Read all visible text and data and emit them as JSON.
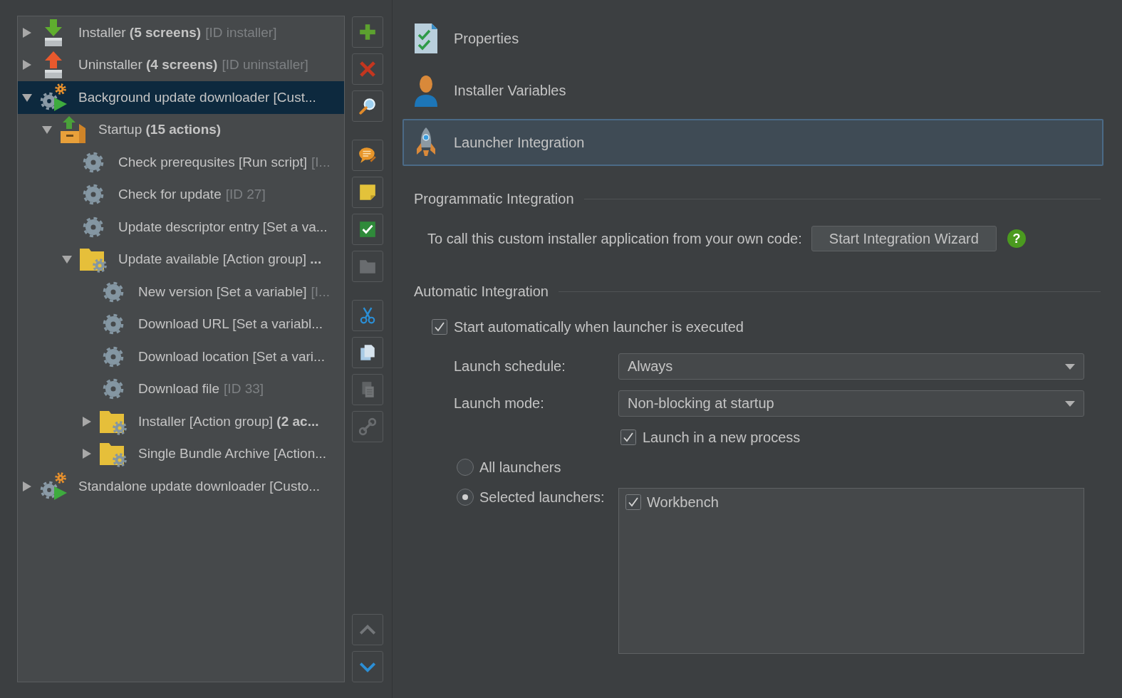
{
  "tree": {
    "items": [
      {
        "kind": "installer",
        "label": "Installer **(5 screens)**",
        "id_note": "[ID installer]",
        "expanded": false,
        "selected": false
      },
      {
        "kind": "uninstaller",
        "label": "Uninstaller **(4 screens)**",
        "id_note": "[ID uninstaller]",
        "expanded": false,
        "selected": false
      },
      {
        "kind": "application",
        "label": "Background update downloader [Cust...",
        "expanded": true,
        "selected": true,
        "children": [
          {
            "kind": "startup",
            "label": "Startup **(15 actions)**",
            "expanded": true,
            "selected": false,
            "children": [
              {
                "kind": "action",
                "label": "Check prerequsites [Run script]",
                "id_note": "[I...",
                "selected": false
              },
              {
                "kind": "action",
                "label": "Check for update",
                "id_note": "[ID 27]",
                "selected": false
              },
              {
                "kind": "action",
                "label": "Update descriptor entry [Set a va...",
                "selected": false
              },
              {
                "kind": "group",
                "label": "Update available [Action group] **...**",
                "expanded": true,
                "selected": false,
                "children": [
                  {
                    "kind": "action",
                    "label": "New version [Set a variable]",
                    "id_note": "[I...",
                    "selected": false
                  },
                  {
                    "kind": "action",
                    "label": "Download URL [Set a variabl...",
                    "selected": false
                  },
                  {
                    "kind": "action",
                    "label": "Download location [Set a vari...",
                    "selected": false
                  },
                  {
                    "kind": "action",
                    "label": "Download file",
                    "id_note": "[ID 33]",
                    "selected": false
                  },
                  {
                    "kind": "group",
                    "label": "Installer [Action group] **(2 ac...**",
                    "expanded": false,
                    "selected": false
                  },
                  {
                    "kind": "group",
                    "label": "Single Bundle Archive [Action...",
                    "expanded": false,
                    "selected": false
                  }
                ]
              }
            ]
          }
        ]
      },
      {
        "kind": "application",
        "label": "Standalone update downloader [Custo...",
        "expanded": false,
        "selected": false
      }
    ]
  },
  "toolbar": {
    "groups": [
      [
        {
          "kind": "add",
          "disabled": false
        },
        {
          "kind": "remove",
          "disabled": false
        },
        {
          "kind": "search",
          "disabled": false
        }
      ],
      [
        {
          "kind": "comment",
          "disabled": false
        },
        {
          "kind": "note",
          "disabled": false
        },
        {
          "kind": "check",
          "disabled": false
        },
        {
          "kind": "folder",
          "disabled": true
        }
      ],
      [
        {
          "kind": "cut",
          "disabled": false
        },
        {
          "kind": "copy",
          "disabled": false
        },
        {
          "kind": "paste",
          "disabled": true
        },
        {
          "kind": "link",
          "disabled": true
        }
      ]
    ],
    "bottom": [
      {
        "kind": "up",
        "disabled": true
      },
      {
        "kind": "down",
        "disabled": false
      }
    ]
  },
  "sections": [
    {
      "kind": "properties",
      "label": "Properties",
      "selected": false
    },
    {
      "kind": "variables",
      "label": "Installer Variables",
      "selected": false
    },
    {
      "kind": "launcher",
      "label": "Launcher Integration",
      "selected": true
    }
  ],
  "programmatic": {
    "title": "Programmatic Integration",
    "text": "To call this custom installer application from your own code:",
    "button": "Start Integration Wizard",
    "help": "?"
  },
  "automatic": {
    "title": "Automatic Integration",
    "start_automatically": {
      "label": "Start automatically when launcher is executed",
      "checked": true
    },
    "fields": [
      {
        "label": "Launch schedule:",
        "value": "Always"
      },
      {
        "label": "Launch mode:",
        "value": "Non-blocking at startup"
      }
    ],
    "new_process": {
      "label": "Launch in a new process",
      "checked": true
    },
    "launcher_choice": [
      {
        "label": "All launchers",
        "selected": false
      },
      {
        "label": "Selected launchers:",
        "selected": true
      }
    ],
    "launchers": [
      {
        "label": "Workbench",
        "checked": true
      }
    ]
  }
}
